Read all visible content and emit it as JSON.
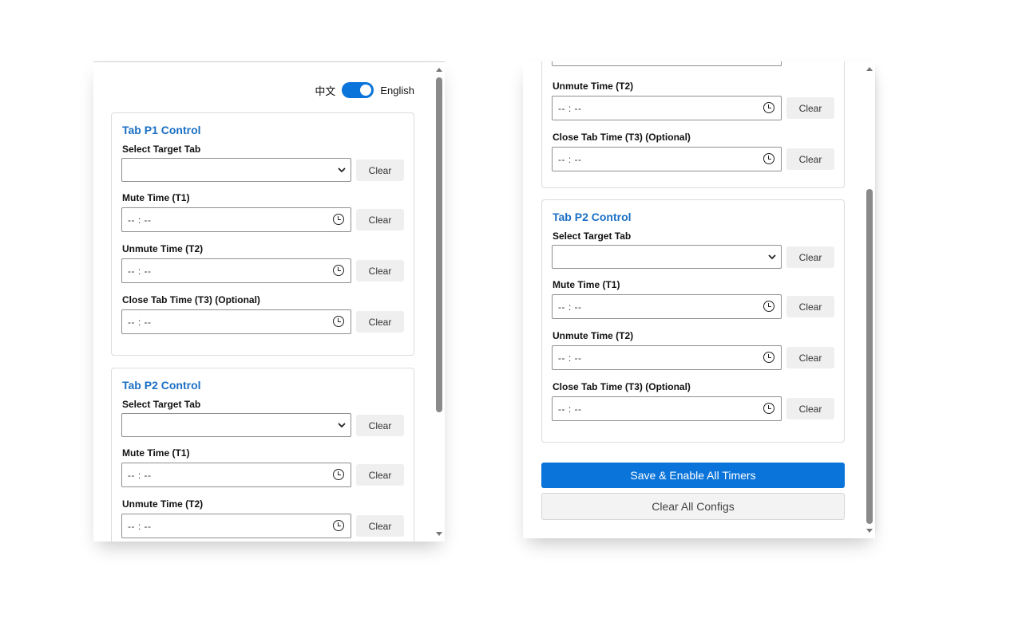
{
  "lang_toggle": {
    "zh": "中文",
    "en": "English"
  },
  "clear_label": "Clear",
  "time_placeholder": "-- : --",
  "labels": {
    "select_tab": "Select Target Tab",
    "mute": "Mute Time (T1)",
    "unmute": "Unmute Time (T2)",
    "close": "Close Tab Time (T3) (Optional)"
  },
  "cards": {
    "p1_title": "Tab P1 Control",
    "p2_title": "Tab P2 Control"
  },
  "actions": {
    "save": "Save & Enable All Timers",
    "clear_all": "Clear All Configs"
  },
  "colors": {
    "accent": "#0a74da",
    "title": "#1a6fc4"
  }
}
